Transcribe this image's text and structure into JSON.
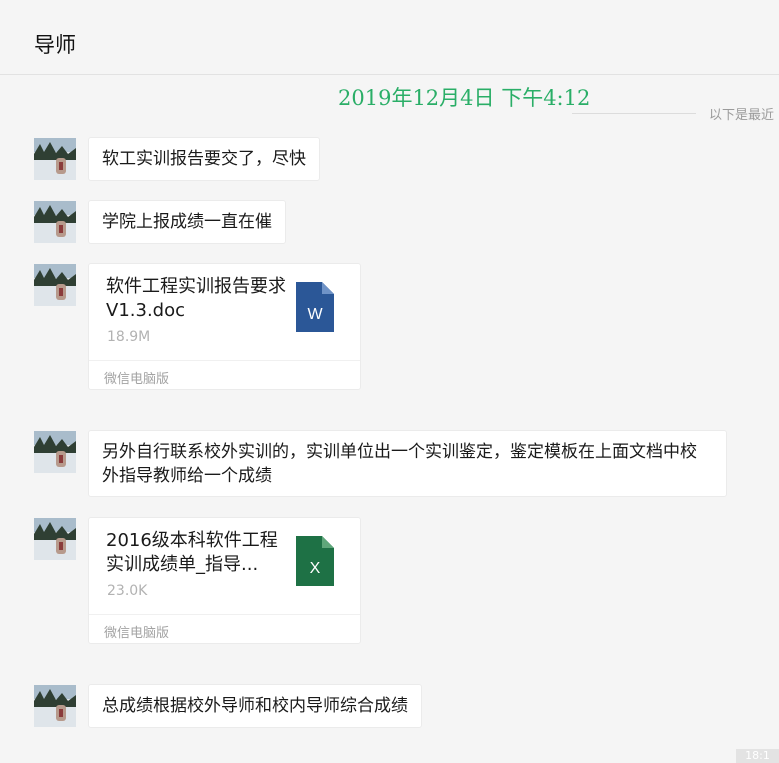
{
  "chat": {
    "title": "导师",
    "timestamp": "2019年12月4日  下午4:12",
    "divider_text": "以下是最近"
  },
  "messages": [
    {
      "type": "text",
      "text": "软工实训报告要交了，尽快"
    },
    {
      "type": "text",
      "text": "学院上报成绩一直在催"
    },
    {
      "type": "file",
      "file_name": "软件工程实训报告要求V1.3.doc",
      "size": "18.9M",
      "source": "微信电脑版",
      "icon": "word-file-icon",
      "icon_letter": "W",
      "icon_color": "#2b5797"
    },
    {
      "type": "text",
      "text": "另外自行联系校外实训的，实训单位出一个实训鉴定，鉴定模板在上面文档中校外指导教师给一个成绩"
    },
    {
      "type": "file",
      "file_name": "2016级本科软件工程实训成绩单_指导...",
      "size": "23.0K",
      "source": "微信电脑版",
      "icon": "excel-file-icon",
      "icon_letter": "X",
      "icon_color": "#1e7145"
    },
    {
      "type": "text",
      "text": "总成绩根据校外导师和校内导师综合成绩"
    }
  ],
  "corner_tag": "18:1",
  "colors": {
    "background": "#f5f5f5",
    "timestamp": "#2aae67",
    "bubble": "#ffffff"
  }
}
